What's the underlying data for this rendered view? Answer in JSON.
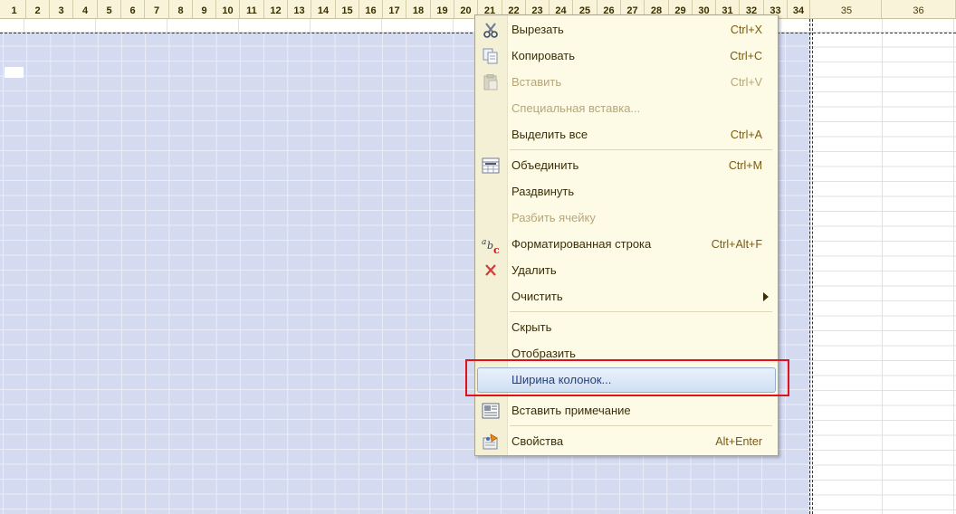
{
  "column_headers": [
    "1",
    "2",
    "3",
    "4",
    "5",
    "6",
    "7",
    "8",
    "9",
    "10",
    "11",
    "12",
    "13",
    "14",
    "15",
    "16",
    "17",
    "18",
    "19",
    "20",
    "21",
    "22",
    "23",
    "24",
    "25",
    "26",
    "27",
    "28",
    "29",
    "30",
    "31",
    "32",
    "33",
    "34",
    "35",
    "36"
  ],
  "context_menu": {
    "items": [
      {
        "label": "Вырезать",
        "shortcut": "Ctrl+X",
        "icon": "scissors-icon",
        "enabled": true
      },
      {
        "label": "Копировать",
        "shortcut": "Ctrl+C",
        "icon": "copy-icon",
        "enabled": true
      },
      {
        "label": "Вставить",
        "shortcut": "Ctrl+V",
        "icon": "paste-icon",
        "enabled": false
      },
      {
        "label": "Специальная вставка...",
        "shortcut": "",
        "icon": "",
        "enabled": false
      },
      {
        "label": "Выделить все",
        "shortcut": "Ctrl+A",
        "icon": "",
        "enabled": true
      },
      {
        "label": "Объединить",
        "shortcut": "Ctrl+M",
        "icon": "merge-cells-icon",
        "enabled": true
      },
      {
        "label": "Раздвинуть",
        "shortcut": "",
        "icon": "",
        "enabled": true
      },
      {
        "label": "Разбить ячейку",
        "shortcut": "",
        "icon": "",
        "enabled": false
      },
      {
        "label": "Форматированная строка",
        "shortcut": "Ctrl+Alt+F",
        "icon": "formatted-string-icon",
        "enabled": true
      },
      {
        "label": "Удалить",
        "shortcut": "",
        "icon": "delete-x-icon",
        "enabled": true
      },
      {
        "label": "Очистить",
        "shortcut": "",
        "icon": "",
        "enabled": true,
        "submenu": true
      },
      {
        "label": "Скрыть",
        "shortcut": "",
        "icon": "",
        "enabled": true
      },
      {
        "label": "Отобразить",
        "shortcut": "",
        "icon": "",
        "enabled": true
      },
      {
        "label": "Ширина колонок...",
        "shortcut": "",
        "icon": "",
        "enabled": true,
        "highlighted": true
      },
      {
        "label": "Вставить примечание",
        "shortcut": "",
        "icon": "insert-note-icon",
        "enabled": true
      },
      {
        "label": "Свойства",
        "shortcut": "Alt+Enter",
        "icon": "properties-icon",
        "enabled": true
      }
    ]
  },
  "colors": {
    "selection_fill": "#d4dbf0",
    "menu_background": "#fdfbe6",
    "highlight_outline": "#e2101c",
    "header_background": "#f8f3d9"
  }
}
